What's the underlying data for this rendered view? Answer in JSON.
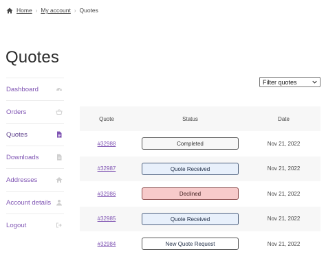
{
  "breadcrumb": {
    "home": "Home",
    "account": "My account",
    "current": "Quotes",
    "separator": "›"
  },
  "page": {
    "title": "Quotes"
  },
  "nav": {
    "items": [
      {
        "label": "Dashboard",
        "icon": "dashboard-icon"
      },
      {
        "label": "Orders",
        "icon": "basket-icon"
      },
      {
        "label": "Quotes",
        "icon": "document-icon",
        "active": true
      },
      {
        "label": "Downloads",
        "icon": "file-icon"
      },
      {
        "label": "Addresses",
        "icon": "home-icon"
      },
      {
        "label": "Account details",
        "icon": "user-icon"
      },
      {
        "label": "Logout",
        "icon": "logout-icon"
      }
    ]
  },
  "filter": {
    "selected": "Filter quotes"
  },
  "table": {
    "headers": {
      "quote": "Quote",
      "status": "Status",
      "date": "Date"
    },
    "rows": [
      {
        "quote": "#32988",
        "status": "Completed",
        "date": "Nov 21, 2022"
      },
      {
        "quote": "#32987",
        "status": "Quote Received",
        "date": "Nov 21, 2022"
      },
      {
        "quote": "#32986",
        "status": "Declined",
        "date": "Nov 21, 2022"
      },
      {
        "quote": "#32985",
        "status": "Quote Received",
        "date": "Nov 21, 2022"
      },
      {
        "quote": "#32984",
        "status": "New Quote Request",
        "date": "Nov 21, 2022"
      }
    ]
  },
  "colors": {
    "accent": "#7f54b3",
    "received_bg": "#e8f0fb",
    "declined_bg": "#f7caca",
    "header_bg": "#f7f7f7"
  }
}
